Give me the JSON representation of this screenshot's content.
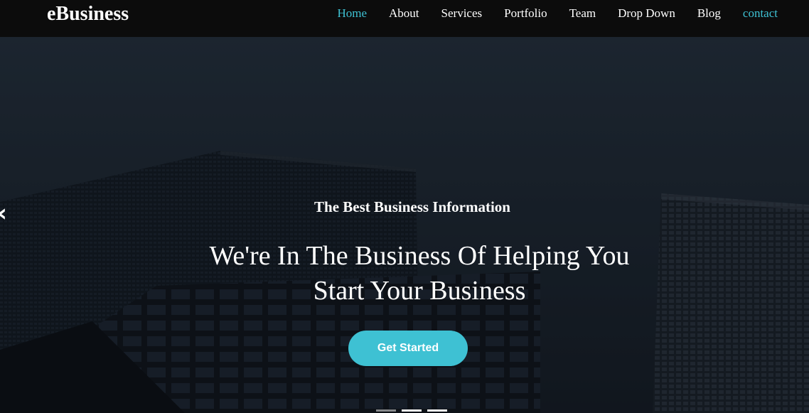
{
  "navbar": {
    "brand": "eBusiness",
    "menu": [
      {
        "label": "Home",
        "state": "active"
      },
      {
        "label": "About",
        "state": ""
      },
      {
        "label": "Services",
        "state": ""
      },
      {
        "label": "Portfolio",
        "state": ""
      },
      {
        "label": "Team",
        "state": ""
      },
      {
        "label": "Drop Down",
        "state": ""
      },
      {
        "label": "Blog",
        "state": ""
      },
      {
        "label": "contact",
        "state": "accent"
      }
    ]
  },
  "hero": {
    "eyebrow": "The Best Business Information",
    "headline_line1": "We're In The Business Of Helping You",
    "headline_line2": "Start Your Business",
    "cta_label": "Get Started",
    "prev_icon": "‹",
    "slides_active": 2,
    "slides_total": 3
  },
  "colors": {
    "accent": "#3ec1d3",
    "navbar_bg": "#0c0c0c",
    "text": "#ffffff"
  },
  "icons": {
    "prev": "chevron-left-icon"
  }
}
